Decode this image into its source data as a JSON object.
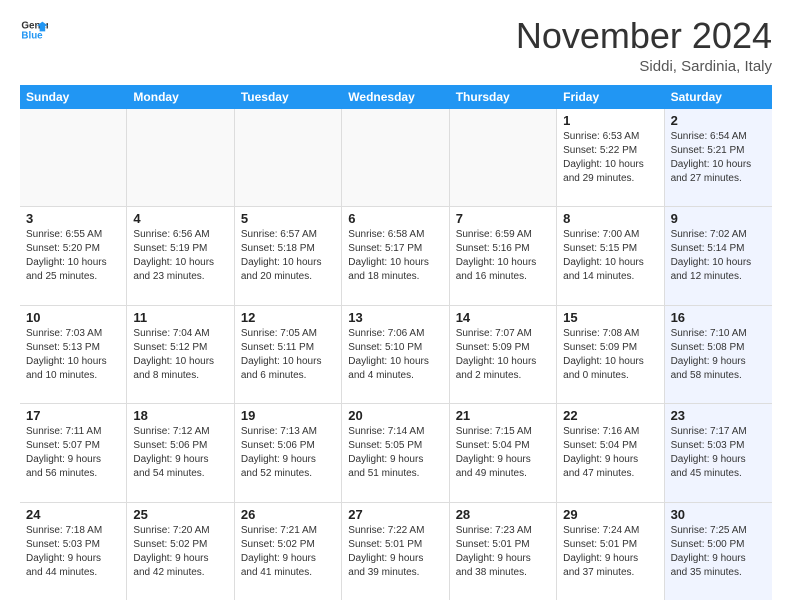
{
  "logo": {
    "line1": "General",
    "line2": "Blue"
  },
  "title": "November 2024",
  "location": "Siddi, Sardinia, Italy",
  "days_of_week": [
    "Sunday",
    "Monday",
    "Tuesday",
    "Wednesday",
    "Thursday",
    "Friday",
    "Saturday"
  ],
  "weeks": [
    [
      {
        "day": "",
        "info": ""
      },
      {
        "day": "",
        "info": ""
      },
      {
        "day": "",
        "info": ""
      },
      {
        "day": "",
        "info": ""
      },
      {
        "day": "",
        "info": ""
      },
      {
        "day": "1",
        "info": "Sunrise: 6:53 AM\nSunset: 5:22 PM\nDaylight: 10 hours\nand 29 minutes."
      },
      {
        "day": "2",
        "info": "Sunrise: 6:54 AM\nSunset: 5:21 PM\nDaylight: 10 hours\nand 27 minutes."
      }
    ],
    [
      {
        "day": "3",
        "info": "Sunrise: 6:55 AM\nSunset: 5:20 PM\nDaylight: 10 hours\nand 25 minutes."
      },
      {
        "day": "4",
        "info": "Sunrise: 6:56 AM\nSunset: 5:19 PM\nDaylight: 10 hours\nand 23 minutes."
      },
      {
        "day": "5",
        "info": "Sunrise: 6:57 AM\nSunset: 5:18 PM\nDaylight: 10 hours\nand 20 minutes."
      },
      {
        "day": "6",
        "info": "Sunrise: 6:58 AM\nSunset: 5:17 PM\nDaylight: 10 hours\nand 18 minutes."
      },
      {
        "day": "7",
        "info": "Sunrise: 6:59 AM\nSunset: 5:16 PM\nDaylight: 10 hours\nand 16 minutes."
      },
      {
        "day": "8",
        "info": "Sunrise: 7:00 AM\nSunset: 5:15 PM\nDaylight: 10 hours\nand 14 minutes."
      },
      {
        "day": "9",
        "info": "Sunrise: 7:02 AM\nSunset: 5:14 PM\nDaylight: 10 hours\nand 12 minutes."
      }
    ],
    [
      {
        "day": "10",
        "info": "Sunrise: 7:03 AM\nSunset: 5:13 PM\nDaylight: 10 hours\nand 10 minutes."
      },
      {
        "day": "11",
        "info": "Sunrise: 7:04 AM\nSunset: 5:12 PM\nDaylight: 10 hours\nand 8 minutes."
      },
      {
        "day": "12",
        "info": "Sunrise: 7:05 AM\nSunset: 5:11 PM\nDaylight: 10 hours\nand 6 minutes."
      },
      {
        "day": "13",
        "info": "Sunrise: 7:06 AM\nSunset: 5:10 PM\nDaylight: 10 hours\nand 4 minutes."
      },
      {
        "day": "14",
        "info": "Sunrise: 7:07 AM\nSunset: 5:09 PM\nDaylight: 10 hours\nand 2 minutes."
      },
      {
        "day": "15",
        "info": "Sunrise: 7:08 AM\nSunset: 5:09 PM\nDaylight: 10 hours\nand 0 minutes."
      },
      {
        "day": "16",
        "info": "Sunrise: 7:10 AM\nSunset: 5:08 PM\nDaylight: 9 hours\nand 58 minutes."
      }
    ],
    [
      {
        "day": "17",
        "info": "Sunrise: 7:11 AM\nSunset: 5:07 PM\nDaylight: 9 hours\nand 56 minutes."
      },
      {
        "day": "18",
        "info": "Sunrise: 7:12 AM\nSunset: 5:06 PM\nDaylight: 9 hours\nand 54 minutes."
      },
      {
        "day": "19",
        "info": "Sunrise: 7:13 AM\nSunset: 5:06 PM\nDaylight: 9 hours\nand 52 minutes."
      },
      {
        "day": "20",
        "info": "Sunrise: 7:14 AM\nSunset: 5:05 PM\nDaylight: 9 hours\nand 51 minutes."
      },
      {
        "day": "21",
        "info": "Sunrise: 7:15 AM\nSunset: 5:04 PM\nDaylight: 9 hours\nand 49 minutes."
      },
      {
        "day": "22",
        "info": "Sunrise: 7:16 AM\nSunset: 5:04 PM\nDaylight: 9 hours\nand 47 minutes."
      },
      {
        "day": "23",
        "info": "Sunrise: 7:17 AM\nSunset: 5:03 PM\nDaylight: 9 hours\nand 45 minutes."
      }
    ],
    [
      {
        "day": "24",
        "info": "Sunrise: 7:18 AM\nSunset: 5:03 PM\nDaylight: 9 hours\nand 44 minutes."
      },
      {
        "day": "25",
        "info": "Sunrise: 7:20 AM\nSunset: 5:02 PM\nDaylight: 9 hours\nand 42 minutes."
      },
      {
        "day": "26",
        "info": "Sunrise: 7:21 AM\nSunset: 5:02 PM\nDaylight: 9 hours\nand 41 minutes."
      },
      {
        "day": "27",
        "info": "Sunrise: 7:22 AM\nSunset: 5:01 PM\nDaylight: 9 hours\nand 39 minutes."
      },
      {
        "day": "28",
        "info": "Sunrise: 7:23 AM\nSunset: 5:01 PM\nDaylight: 9 hours\nand 38 minutes."
      },
      {
        "day": "29",
        "info": "Sunrise: 7:24 AM\nSunset: 5:01 PM\nDaylight: 9 hours\nand 37 minutes."
      },
      {
        "day": "30",
        "info": "Sunrise: 7:25 AM\nSunset: 5:00 PM\nDaylight: 9 hours\nand 35 minutes."
      }
    ]
  ]
}
